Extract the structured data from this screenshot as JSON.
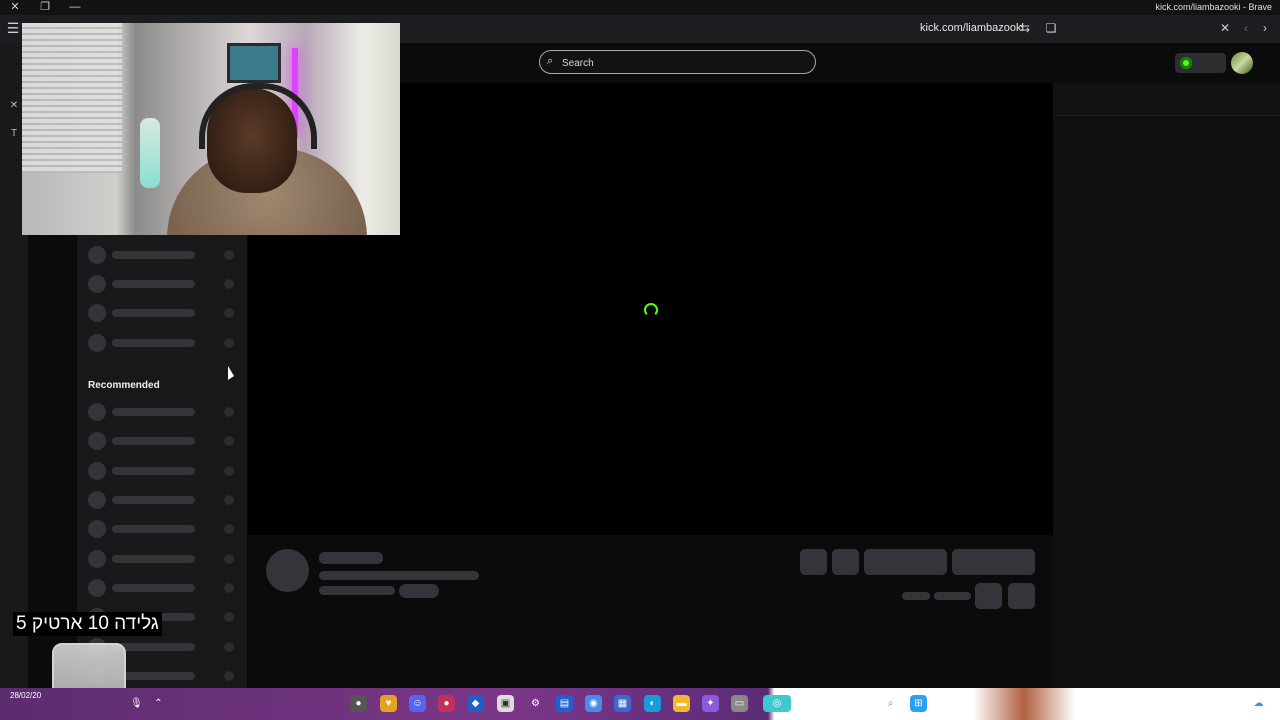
{
  "window": {
    "title": "kick.com/liambazooki - Brave"
  },
  "toolbar": {
    "url": "kick.com/liambazooki"
  },
  "search": {
    "placeholder": "Search"
  },
  "sidebar": {
    "recommended_heading": "Recommended"
  },
  "overlay": {
    "caption": "גלידה 10 ארטיק 5"
  },
  "taskbar": {
    "date": "28/02/20"
  },
  "colors": {
    "brand_accent": "#53fc18",
    "page_background": "#0b0b0c",
    "sidebar_background": "#18181b"
  },
  "icons": [
    "close-icon",
    "restore-icon",
    "minimize-icon",
    "sidebar-toggle-icon",
    "search-icon",
    "translate-icon",
    "bookmark-icon",
    "back-icon",
    "forward-icon",
    "loading-spinner-icon"
  ]
}
